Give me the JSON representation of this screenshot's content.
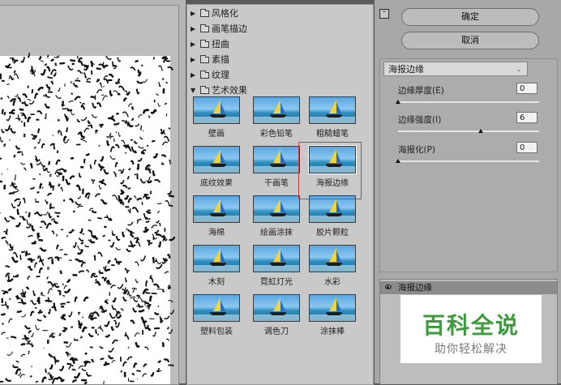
{
  "gallery": {
    "categories": [
      {
        "label": "风格化",
        "expanded": false
      },
      {
        "label": "画笔描边",
        "expanded": false
      },
      {
        "label": "扭曲",
        "expanded": false
      },
      {
        "label": "素描",
        "expanded": false
      },
      {
        "label": "纹理",
        "expanded": false
      },
      {
        "label": "艺术效果",
        "expanded": true
      }
    ],
    "filters": [
      "壁画",
      "彩色铅笔",
      "粗糙蜡笔",
      "底纹效果",
      "干画笔",
      "海报边缘",
      "海绵",
      "绘画涂抹",
      "胶片颗粒",
      "木刻",
      "霓虹灯光",
      "水彩",
      "塑料包装",
      "调色刀",
      "涂抹棒"
    ],
    "selected_filter": "海报边缘"
  },
  "buttons": {
    "ok": "确定",
    "cancel": "取消"
  },
  "settings": {
    "filter_select": "海报边缘",
    "params": [
      {
        "label": "边缘厚度(E)",
        "value": "0",
        "slider": 0.0
      },
      {
        "label": "边缘强度(I)",
        "value": "6",
        "slider": 0.6
      },
      {
        "label": "海报化(P)",
        "value": "0",
        "slider": 0.0
      }
    ]
  },
  "layers": {
    "items": [
      {
        "label": "海报边缘"
      }
    ]
  },
  "watermark": {
    "title": "百科全说",
    "subtitle": "助你轻松解决"
  },
  "icons": {
    "collapse": "collapse-icon",
    "eye": "eye-icon",
    "folder": "folder-icon"
  },
  "colors": {
    "selection_border": "#d23b3b",
    "watermark_green": "#3d9a3d"
  }
}
